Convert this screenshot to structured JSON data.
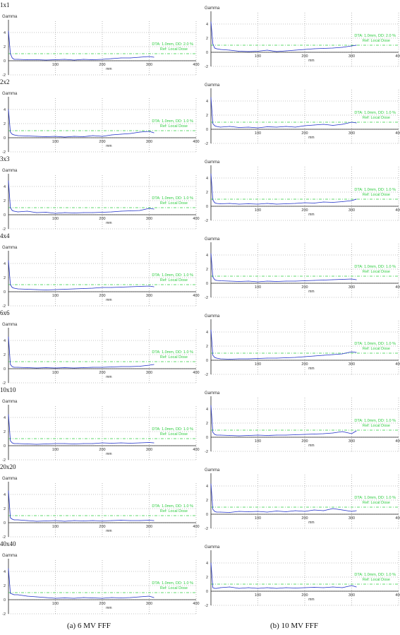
{
  "columns": [
    {
      "caption_tag": "(a)",
      "caption_text": "6 MV FFF"
    },
    {
      "caption_tag": "(b)",
      "caption_text": "10 MV FFF"
    }
  ],
  "rows": [
    "1x1",
    "2x2",
    "3x3",
    "4x4",
    "6x6",
    "10x10",
    "20x20",
    "40x40"
  ],
  "axis": {
    "ylabel": "Gamma",
    "xlabel": "mm",
    "yticks": [
      4,
      2,
      0,
      -2
    ],
    "xticks": [
      100,
      200,
      300,
      400
    ],
    "xlim": [
      0,
      400
    ],
    "ylim": [
      -2,
      5
    ]
  },
  "colors": {
    "line": "#1f2fc8",
    "threshold": "#2ecc40",
    "grid": "#8a8a8a",
    "axis": "#222222"
  },
  "chart_data": [
    {
      "type": "line",
      "row": "1x1",
      "column": "6 MV FFF",
      "annotation": [
        "DTA: 1.0mm, DD: 2.0 %",
        "Ref: Local Dose"
      ],
      "threshold": 1,
      "x": [
        0,
        4,
        8,
        12,
        20,
        40,
        60,
        80,
        100,
        120,
        140,
        160,
        180,
        200,
        220,
        240,
        260,
        280,
        300,
        310
      ],
      "values": [
        4.2,
        1.0,
        0.4,
        0.2,
        0.2,
        0.15,
        0.15,
        0.1,
        0.15,
        0.2,
        0.1,
        0.2,
        0.15,
        0.2,
        0.3,
        0.4,
        0.4,
        0.5,
        0.6,
        0.5
      ]
    },
    {
      "type": "line",
      "row": "1x1",
      "column": "10 MV FFF",
      "annotation": [
        "DTA: 1.0mm, DD: 2.0 %",
        "Ref: Local Dose"
      ],
      "threshold": 1,
      "x": [
        0,
        4,
        8,
        12,
        20,
        40,
        60,
        80,
        100,
        120,
        140,
        160,
        180,
        200,
        220,
        240,
        260,
        280,
        300,
        310
      ],
      "values": [
        4.3,
        1.2,
        0.6,
        0.5,
        0.4,
        0.3,
        0.15,
        0.1,
        0.15,
        0.3,
        0.1,
        0.2,
        0.3,
        0.4,
        0.5,
        0.55,
        0.6,
        0.7,
        0.9,
        1.0
      ]
    },
    {
      "type": "line",
      "row": "2x2",
      "column": "6 MV FFF",
      "annotation": [
        "DTA: 1.0mm, DD: 1.0 %",
        "Ref: Local Dose"
      ],
      "threshold": 1,
      "x": [
        0,
        4,
        8,
        12,
        20,
        40,
        60,
        80,
        100,
        120,
        140,
        160,
        180,
        200,
        220,
        240,
        260,
        280,
        300,
        310
      ],
      "values": [
        4.0,
        0.8,
        0.5,
        0.4,
        0.3,
        0.25,
        0.2,
        0.15,
        0.2,
        0.1,
        0.2,
        0.15,
        0.3,
        0.2,
        0.4,
        0.5,
        0.6,
        0.8,
        0.9,
        0.7
      ]
    },
    {
      "type": "line",
      "row": "2x2",
      "column": "10 MV FFF",
      "annotation": [
        "DTA: 1.0mm, DD: 1.0 %",
        "Ref: Local Dose"
      ],
      "threshold": 1,
      "x": [
        0,
        4,
        8,
        12,
        20,
        40,
        60,
        80,
        100,
        120,
        140,
        160,
        180,
        200,
        220,
        240,
        260,
        280,
        300,
        310
      ],
      "values": [
        4.5,
        0.8,
        0.5,
        0.4,
        0.3,
        0.4,
        0.25,
        0.3,
        0.2,
        0.35,
        0.3,
        0.4,
        0.3,
        0.5,
        0.6,
        0.7,
        0.55,
        0.7,
        1.0,
        0.9
      ]
    },
    {
      "type": "line",
      "row": "3x3",
      "column": "6 MV FFF",
      "annotation": [
        "DTA: 1.0mm, DD: 1.0 %",
        "Ref: Local Dose"
      ],
      "threshold": 1,
      "x": [
        0,
        4,
        8,
        12,
        20,
        40,
        60,
        80,
        100,
        120,
        140,
        160,
        180,
        200,
        220,
        240,
        260,
        280,
        300,
        310
      ],
      "values": [
        4.8,
        1.0,
        0.6,
        0.5,
        0.4,
        0.5,
        0.3,
        0.35,
        0.2,
        0.3,
        0.25,
        0.3,
        0.3,
        0.35,
        0.4,
        0.5,
        0.55,
        0.6,
        0.9,
        0.8
      ]
    },
    {
      "type": "line",
      "row": "3x3",
      "column": "10 MV FFF",
      "annotation": [
        "DTA: 1.0mm, DD: 1.0 %",
        "Ref: Local Dose"
      ],
      "threshold": 1,
      "x": [
        0,
        4,
        8,
        12,
        20,
        40,
        60,
        80,
        100,
        120,
        140,
        160,
        180,
        200,
        220,
        240,
        260,
        280,
        300,
        310
      ],
      "values": [
        4.6,
        0.9,
        0.5,
        0.4,
        0.35,
        0.4,
        0.3,
        0.35,
        0.3,
        0.4,
        0.3,
        0.35,
        0.4,
        0.5,
        0.45,
        0.6,
        0.55,
        0.65,
        0.8,
        1.0
      ]
    },
    {
      "type": "line",
      "row": "4x4",
      "column": "6 MV FFF",
      "annotation": [
        "DTA: 1.0mm, DD: 1.0 %",
        "Ref: Local Dose"
      ],
      "threshold": 1,
      "x": [
        0,
        4,
        8,
        12,
        20,
        40,
        60,
        80,
        100,
        120,
        140,
        160,
        180,
        200,
        220,
        240,
        260,
        280,
        300,
        310
      ],
      "values": [
        4.4,
        1.0,
        0.6,
        0.5,
        0.4,
        0.35,
        0.3,
        0.25,
        0.3,
        0.35,
        0.4,
        0.45,
        0.5,
        0.6,
        0.6,
        0.65,
        0.7,
        0.75,
        0.8,
        0.7
      ]
    },
    {
      "type": "line",
      "row": "4x4",
      "column": "10 MV FFF",
      "annotation": [
        "DTA: 1.0mm, DD: 1.0 %",
        "Ref: Local Dose"
      ],
      "threshold": 1,
      "x": [
        0,
        4,
        8,
        12,
        20,
        40,
        60,
        80,
        100,
        120,
        140,
        160,
        180,
        200,
        220,
        240,
        260,
        280,
        300,
        310
      ],
      "values": [
        4.2,
        0.9,
        0.5,
        0.4,
        0.35,
        0.3,
        0.25,
        0.3,
        0.2,
        0.3,
        0.25,
        0.3,
        0.3,
        0.35,
        0.4,
        0.45,
        0.5,
        0.55,
        0.6,
        0.5
      ]
    },
    {
      "type": "line",
      "row": "6x6",
      "column": "6 MV FFF",
      "annotation": [
        "DTA: 1.0mm, DD: 1.0 %",
        "Ref: Local Dose"
      ],
      "threshold": 1,
      "x": [
        0,
        4,
        8,
        12,
        20,
        40,
        60,
        80,
        100,
        120,
        140,
        160,
        180,
        200,
        220,
        240,
        260,
        280,
        300,
        310
      ],
      "values": [
        4.5,
        0.6,
        0.3,
        0.2,
        0.2,
        0.15,
        0.1,
        0.15,
        0.1,
        0.15,
        0.1,
        0.15,
        0.2,
        0.2,
        0.25,
        0.3,
        0.3,
        0.35,
        0.5,
        0.6
      ]
    },
    {
      "type": "line",
      "row": "6x6",
      "column": "10 MV FFF",
      "annotation": [
        "DTA: 1.0mm, DD: 1.0 %",
        "Ref: Local Dose"
      ],
      "threshold": 1,
      "x": [
        0,
        4,
        8,
        12,
        20,
        40,
        60,
        80,
        100,
        120,
        140,
        160,
        180,
        200,
        220,
        240,
        260,
        280,
        300,
        310
      ],
      "values": [
        4.3,
        0.7,
        0.4,
        0.3,
        0.2,
        0.15,
        0.2,
        0.2,
        0.25,
        0.3,
        0.3,
        0.35,
        0.4,
        0.5,
        0.6,
        0.7,
        0.8,
        0.9,
        1.2,
        1.1
      ]
    },
    {
      "type": "line",
      "row": "10x10",
      "column": "6 MV FFF",
      "annotation": [
        "DTA: 1.0mm, DD: 1.0 %",
        "Ref: Local Dose"
      ],
      "threshold": 1,
      "x": [
        0,
        4,
        8,
        12,
        20,
        40,
        60,
        80,
        100,
        120,
        140,
        160,
        180,
        200,
        220,
        240,
        260,
        280,
        300,
        310
      ],
      "values": [
        4.4,
        0.7,
        0.4,
        0.3,
        0.3,
        0.25,
        0.2,
        0.25,
        0.3,
        0.3,
        0.25,
        0.3,
        0.3,
        0.4,
        0.35,
        0.4,
        0.35,
        0.4,
        0.45,
        0.4
      ]
    },
    {
      "type": "line",
      "row": "10x10",
      "column": "10 MV FFF",
      "annotation": [
        "DTA: 1.0mm, DD: 1.0 %",
        "Ref: Local Dose"
      ],
      "threshold": 1,
      "x": [
        0,
        4,
        8,
        12,
        20,
        40,
        60,
        80,
        100,
        120,
        140,
        160,
        180,
        200,
        220,
        240,
        260,
        280,
        300,
        310
      ],
      "values": [
        4.5,
        0.7,
        0.4,
        0.3,
        0.3,
        0.25,
        0.2,
        0.25,
        0.3,
        0.25,
        0.3,
        0.3,
        0.35,
        0.4,
        0.45,
        0.5,
        0.6,
        0.8,
        0.5,
        0.9
      ]
    },
    {
      "type": "line",
      "row": "20x20",
      "column": "6 MV FFF",
      "annotation": [
        "DTA: 1.0mm, DD: 1.0 %",
        "Ref: Local Dose"
      ],
      "threshold": 1,
      "x": [
        0,
        4,
        8,
        12,
        20,
        40,
        60,
        80,
        100,
        120,
        140,
        160,
        180,
        200,
        220,
        240,
        260,
        280,
        300,
        310
      ],
      "values": [
        4.5,
        0.7,
        0.5,
        0.4,
        0.4,
        0.3,
        0.2,
        0.25,
        0.3,
        0.2,
        0.3,
        0.25,
        0.3,
        0.25,
        0.3,
        0.35,
        0.3,
        0.3,
        0.35,
        0.3
      ]
    },
    {
      "type": "line",
      "row": "20x20",
      "column": "10 MV FFF",
      "annotation": [
        "DTA: 1.0mm, DD: 1.0 %",
        "Ref: Local Dose"
      ],
      "threshold": 1,
      "x": [
        0,
        4,
        8,
        12,
        20,
        40,
        60,
        80,
        100,
        120,
        140,
        160,
        180,
        200,
        220,
        240,
        260,
        280,
        300,
        310
      ],
      "values": [
        4.3,
        0.7,
        0.4,
        0.3,
        0.3,
        0.25,
        0.4,
        0.35,
        0.4,
        0.3,
        0.45,
        0.35,
        0.5,
        0.4,
        0.6,
        0.5,
        0.8,
        0.6,
        0.4,
        0.5
      ]
    },
    {
      "type": "line",
      "row": "40x40",
      "column": "6 MV FFF",
      "annotation": [
        "DTA: 1.0mm, DD: 1.0 %",
        "Ref: Local Dose"
      ],
      "threshold": 1,
      "x": [
        0,
        4,
        8,
        12,
        20,
        40,
        60,
        80,
        100,
        120,
        140,
        160,
        180,
        200,
        220,
        240,
        260,
        280,
        300,
        310
      ],
      "values": [
        4.4,
        0.9,
        0.8,
        0.7,
        0.7,
        0.5,
        0.4,
        0.3,
        0.2,
        0.25,
        0.2,
        0.3,
        0.25,
        0.2,
        0.3,
        0.25,
        0.3,
        0.4,
        0.5,
        0.3
      ]
    },
    {
      "type": "line",
      "row": "40x40",
      "column": "10 MV FFF",
      "annotation": [
        "DTA: 1.0mm, DD: 1.0 %",
        "Ref: Local Dose"
      ],
      "threshold": 1,
      "x": [
        0,
        4,
        8,
        12,
        20,
        40,
        60,
        80,
        100,
        120,
        140,
        160,
        180,
        200,
        220,
        240,
        260,
        280,
        300,
        310
      ],
      "values": [
        4.0,
        0.5,
        0.4,
        0.4,
        0.5,
        0.6,
        0.4,
        0.5,
        0.4,
        0.5,
        0.4,
        0.5,
        0.45,
        0.5,
        0.55,
        0.5,
        0.6,
        0.5,
        0.8,
        0.6
      ]
    }
  ]
}
